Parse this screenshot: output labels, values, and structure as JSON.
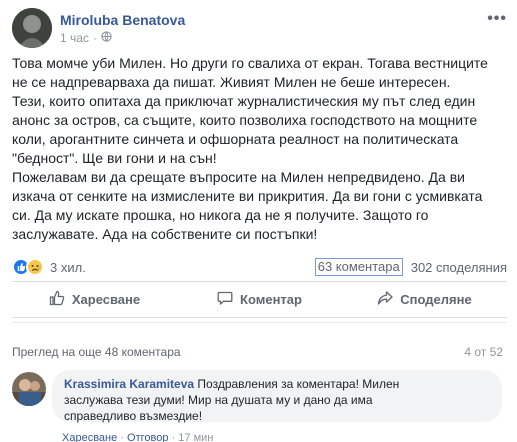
{
  "post": {
    "author": "Miroluba Benatova",
    "time": "1 час",
    "text_lines": [
      "Това момче уби Милен. Но други го свалиха от екран. Тогава вестниците",
      "не се надпреварваха да пишат. Живият Милен не беше интересен.",
      "Тези, които опитаха да приключат журналистическия му път след един",
      "анонс за остров, са същите, които позволиха господството на мощните",
      "коли, арогантните синчета и офшорната реалност на политическата",
      "\"бедност\". Ще ви гони и на сън!",
      "Пожелавам ви да срещате въпросите на Милен непредвидено. Да ви",
      "изкача от сенките на измислените ви прикрития. Да ви гони с усмивката",
      "си. Да му искате прошка, но никога да не я получите. Защото го",
      "заслужавате. Ада на собствените си постъпки!"
    ]
  },
  "stats": {
    "reactions": "3 хил.",
    "comments": "63 коментара",
    "shares": "302 споделяния"
  },
  "actions": {
    "like": "Харесване",
    "comment": "Коментар",
    "share": "Споделяне"
  },
  "comments_section": {
    "view_more": "Преглед на още 48 коментара",
    "page": "4 от 52",
    "comment": {
      "name": "Krassimira Karamiteva",
      "text_line1": " Поздравления за коментара! Милен",
      "text_line2": "заслужава тези думи! Мир на душата му и дано да има",
      "text_line3": "справедливо възмездие!",
      "like": "Харесване",
      "reply": "Отговор",
      "time": "17 мин"
    }
  },
  "colors": {
    "link": "#385898",
    "like_blue": "#1877f2",
    "sad_yellow": "#f7c64a"
  }
}
